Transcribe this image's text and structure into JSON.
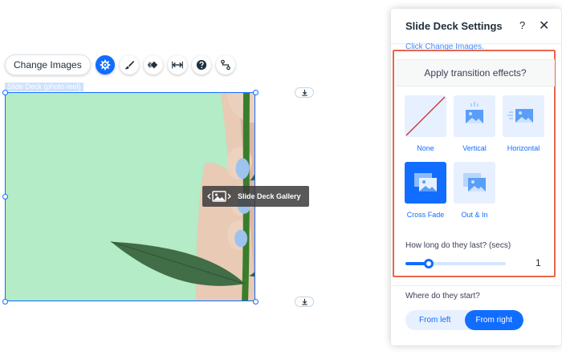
{
  "toolbar": {
    "change_images_label": "Change Images",
    "icons": [
      "gear-icon",
      "brush-icon",
      "animation-icon",
      "stretch-icon",
      "help-icon",
      "connect-icon"
    ]
  },
  "component": {
    "label": "Slide Deck (photo reel)",
    "gallery_badge": "Slide Deck Gallery",
    "background_color": "#b3ecc6"
  },
  "panel": {
    "title": "Slide Deck Settings",
    "help": "?",
    "close": "✕",
    "scrolled_text": "Click Change Images.",
    "transition_heading": "Apply transition effects?",
    "transitions": [
      {
        "label": "None",
        "selected": false
      },
      {
        "label": "Vertical",
        "selected": false
      },
      {
        "label": "Horizontal",
        "selected": false
      },
      {
        "label": "Cross Fade",
        "selected": true
      },
      {
        "label": "Out & In",
        "selected": false
      }
    ],
    "duration_label": "How long do they last? (secs)",
    "duration_value": "1",
    "duration_fraction": 0.23,
    "start_label": "Where do they start?",
    "start_options": [
      {
        "label": "From left",
        "active": false
      },
      {
        "label": "From right",
        "active": true
      }
    ]
  },
  "colors": {
    "accent": "#116dff",
    "highlight": "#e8664c",
    "tile_bg": "#e7f0ff"
  }
}
